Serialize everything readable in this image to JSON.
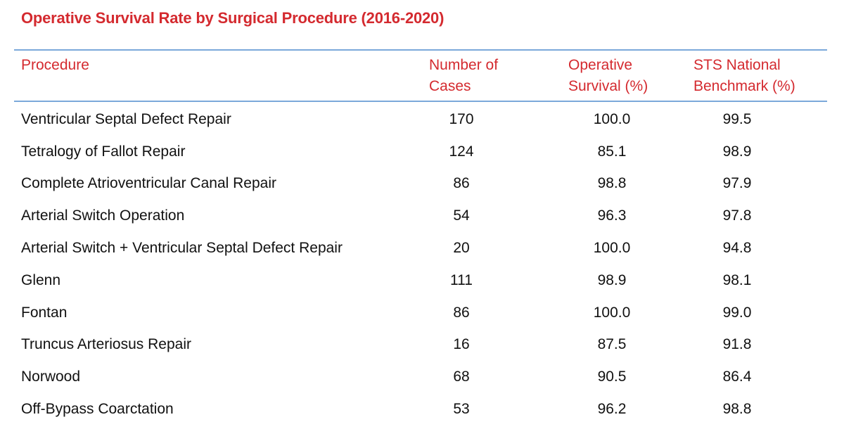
{
  "title": "Operative Survival Rate by Surgical Procedure (2016-2020)",
  "colors": {
    "accent_red": "#d42a2f",
    "rule_blue": "#7ba9da",
    "text": "#111111"
  },
  "table": {
    "headers": {
      "procedure": "Procedure",
      "cases_line1": "Number of",
      "cases_line2": "Cases",
      "survival_line1": "Operative",
      "survival_line2": "Survival (%)",
      "benchmark_line1": "STS National",
      "benchmark_line2": "Benchmark (%)"
    },
    "rows": [
      {
        "procedure": "Ventricular Septal Defect Repair",
        "cases": "170",
        "survival": "100.0",
        "benchmark": "99.5"
      },
      {
        "procedure": "Tetralogy of Fallot Repair",
        "cases": "124",
        "survival": "85.1",
        "benchmark": "98.9"
      },
      {
        "procedure": "Complete Atrioventricular Canal Repair",
        "cases": "86",
        "survival": "98.8",
        "benchmark": "97.9"
      },
      {
        "procedure": "Arterial Switch Operation",
        "cases": "54",
        "survival": "96.3",
        "benchmark": "97.8"
      },
      {
        "procedure": "Arterial Switch + Ventricular Septal Defect Repair",
        "cases": "20",
        "survival": "100.0",
        "benchmark": "94.8"
      },
      {
        "procedure": "Glenn",
        "cases": "111",
        "survival": "98.9",
        "benchmark": "98.1"
      },
      {
        "procedure": "Fontan",
        "cases": "86",
        "survival": "100.0",
        "benchmark": "99.0"
      },
      {
        "procedure": "Truncus Arteriosus Repair",
        "cases": "16",
        "survival": "87.5",
        "benchmark": "91.8"
      },
      {
        "procedure": "Norwood",
        "cases": "68",
        "survival": "90.5",
        "benchmark": "86.4"
      },
      {
        "procedure": "Off-Bypass Coarctation",
        "cases": "53",
        "survival": "96.2",
        "benchmark": "98.8"
      }
    ]
  }
}
